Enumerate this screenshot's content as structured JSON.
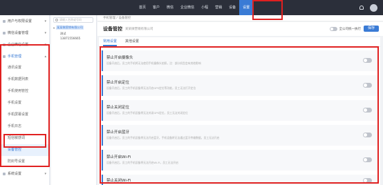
{
  "topnav": {
    "items": [
      "首页",
      "客户",
      "微信",
      "企业微信",
      "小程",
      "营销",
      "设备",
      "设置"
    ],
    "active_index": 7
  },
  "sidebar": {
    "groups": [
      {
        "label": "用户与权限设置",
        "open": false
      },
      {
        "label": "微信设备管理",
        "open": false
      },
      {
        "label": "企业微信设置",
        "open": false
      },
      {
        "label": "手机管理",
        "open": true
      },
      {
        "label": "系统设置",
        "open": false
      }
    ],
    "items": [
      "通讯设置",
      "手机数据列表",
      "手机使用管控",
      "手机设置",
      "手机屏幕设置",
      "手机日志",
      "短信敏感词",
      "设备管控",
      "防封号设置"
    ],
    "active_item": "设备管控"
  },
  "tree": {
    "search_placeholder": "请输入名称或号码",
    "root_label": "某某微营销有限公司",
    "child_name": "测试",
    "child_phone": "13871556665"
  },
  "breadcrumb": "手机管理 / 设备管控",
  "header": {
    "title": "设备管控",
    "company": "某某微营销有限公司",
    "apply_all_label": "全公司统一执行",
    "save_label": "保存"
  },
  "tabs": [
    "常用设置",
    "其他设置"
  ],
  "settings": [
    {
      "title": "禁止开启摄像头",
      "desc": "设备开启后，员工的手机将无法使用手机摄像头拍照，注：部分机型会有其他影响"
    },
    {
      "title": "禁止开启定位",
      "desc": "设备开启后，员工的手机设备将无法开启GPS定位等功能，员工无法打开定位"
    },
    {
      "title": "禁止关闭定位",
      "desc": "设备开启后，员工的手机设备将无法关闭GPS定位，员工无法关闭定位"
    },
    {
      "title": "禁止开启蓝牙",
      "desc": "设备开启后，员工的手机设备将无法开启蓝牙，手机设备将无法通过蓝牙传输数据，员工无法开启"
    },
    {
      "title": "禁止开启Wi-Fi",
      "desc": "设备开启后，员工的手机设备将无法开启Wi-Fi，员工无法开启"
    },
    {
      "title": "禁止关闭Wi-Fi",
      "desc": ""
    }
  ],
  "colors": {
    "accent": "#3a7bd5",
    "highlight": "#e02020",
    "topbar": "#2b2f3a"
  }
}
